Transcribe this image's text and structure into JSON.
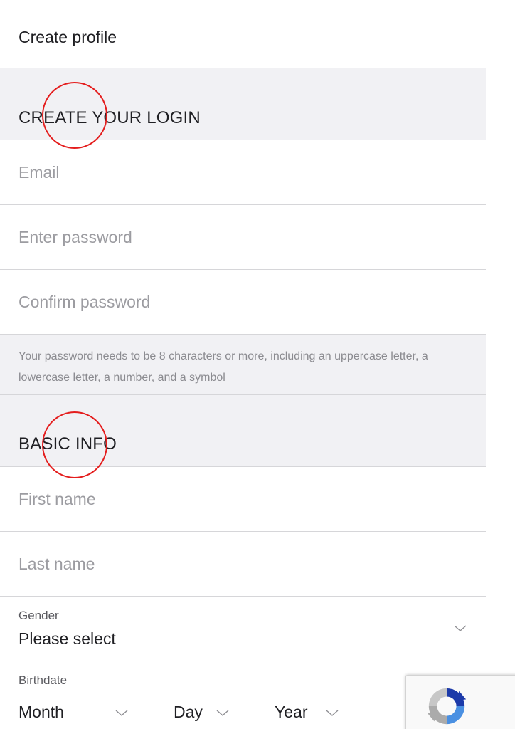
{
  "header": {
    "title": "Create profile"
  },
  "login_section": {
    "heading": "CREATE YOUR LOGIN",
    "email_placeholder": "Email",
    "password_placeholder": "Enter password",
    "confirm_placeholder": "Confirm password",
    "password_hint": "Your password needs to be 8 characters or more, including an uppercase letter, a lowercase letter, a number, and a symbol"
  },
  "basic_section": {
    "heading": "BASIC INFO",
    "first_name_placeholder": "First name",
    "last_name_placeholder": "Last name",
    "gender_label": "Gender",
    "gender_value": "Please select",
    "birthdate_label": "Birthdate",
    "month_value": "Month",
    "day_value": "Day",
    "year_value": "Year"
  },
  "icons": {
    "chevron": "chevron-down-icon",
    "recaptcha": "recaptcha-icon"
  },
  "colors": {
    "annotation_circle": "#e41d1d",
    "section_background": "#f1f1f4",
    "divider": "#d6d6d9",
    "placeholder": "#9c9ca1"
  }
}
